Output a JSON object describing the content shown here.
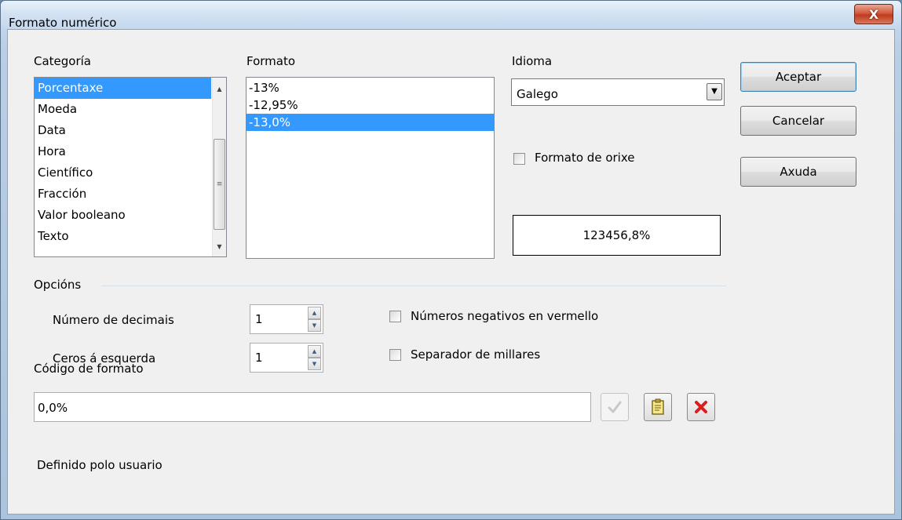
{
  "window": {
    "title": "Formato numérico",
    "close_label": "X"
  },
  "categoria": {
    "label": "Categoría",
    "items": [
      "Porcentaxe",
      "Moeda",
      "Data",
      "Hora",
      "Científico",
      "Fracción",
      "Valor booleano",
      "Texto"
    ],
    "selected_index": 0
  },
  "formato": {
    "label": "Formato",
    "items": [
      "-13%",
      "-12,95%",
      "-13,0%"
    ],
    "selected_index": 2
  },
  "idioma": {
    "label": "Idioma",
    "value": "Galego"
  },
  "formato_orixe": {
    "label": "Formato de orixe",
    "checked": false
  },
  "preview": {
    "value": "123456,8%"
  },
  "buttons": {
    "ok": "Aceptar",
    "cancel": "Cancelar",
    "help": "Axuda"
  },
  "opcions": {
    "label": "Opcións",
    "decimais_label": "Número de decimais",
    "decimais_value": "1",
    "ceros_label": "Ceros á esquerda",
    "ceros_value": "1",
    "negativos_label": "Números negativos en vermello",
    "negativos_checked": false,
    "separador_label": "Separador de millares",
    "separador_checked": false
  },
  "codigo": {
    "label": "Código de formato",
    "value": "0,0%",
    "status": "Definido polo usuario"
  },
  "icons": {
    "accept": "check-icon",
    "comment": "comment-icon",
    "delete": "delete-icon"
  },
  "colors": {
    "selection": "#3399ff",
    "delete_icon": "#d81e1e"
  }
}
